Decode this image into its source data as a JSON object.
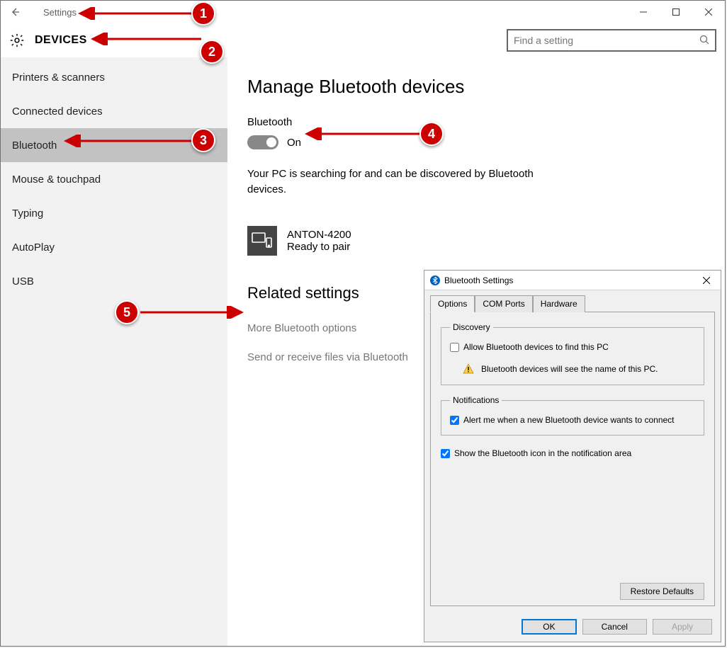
{
  "window": {
    "title": "Settings",
    "page": "DEVICES",
    "search_placeholder": "Find a setting"
  },
  "sidebar": {
    "items": [
      {
        "label": "Printers & scanners"
      },
      {
        "label": "Connected devices"
      },
      {
        "label": "Bluetooth"
      },
      {
        "label": "Mouse & touchpad"
      },
      {
        "label": "Typing"
      },
      {
        "label": "AutoPlay"
      },
      {
        "label": "USB"
      }
    ]
  },
  "main": {
    "heading": "Manage Bluetooth devices",
    "toggle_label": "Bluetooth",
    "toggle_state": "On",
    "status_text": "Your PC is searching for and can be discovered by Bluetooth devices.",
    "device": {
      "name": "ANTON-4200",
      "status": "Ready to pair"
    },
    "related_heading": "Related settings",
    "links": [
      "More Bluetooth options",
      "Send or receive files via Bluetooth"
    ]
  },
  "dialog": {
    "title": "Bluetooth Settings",
    "tabs": [
      "Options",
      "COM Ports",
      "Hardware"
    ],
    "discovery": {
      "legend": "Discovery",
      "allow": "Allow Bluetooth devices to find this PC",
      "warn": "Bluetooth devices will see the name of this PC."
    },
    "notifications": {
      "legend": "Notifications",
      "alert": "Alert me when a new Bluetooth device wants to connect"
    },
    "show_icon": "Show the Bluetooth icon in the notification area",
    "restore": "Restore Defaults",
    "ok": "OK",
    "cancel": "Cancel",
    "apply": "Apply"
  },
  "annotations": [
    "1",
    "2",
    "3",
    "4",
    "5"
  ]
}
